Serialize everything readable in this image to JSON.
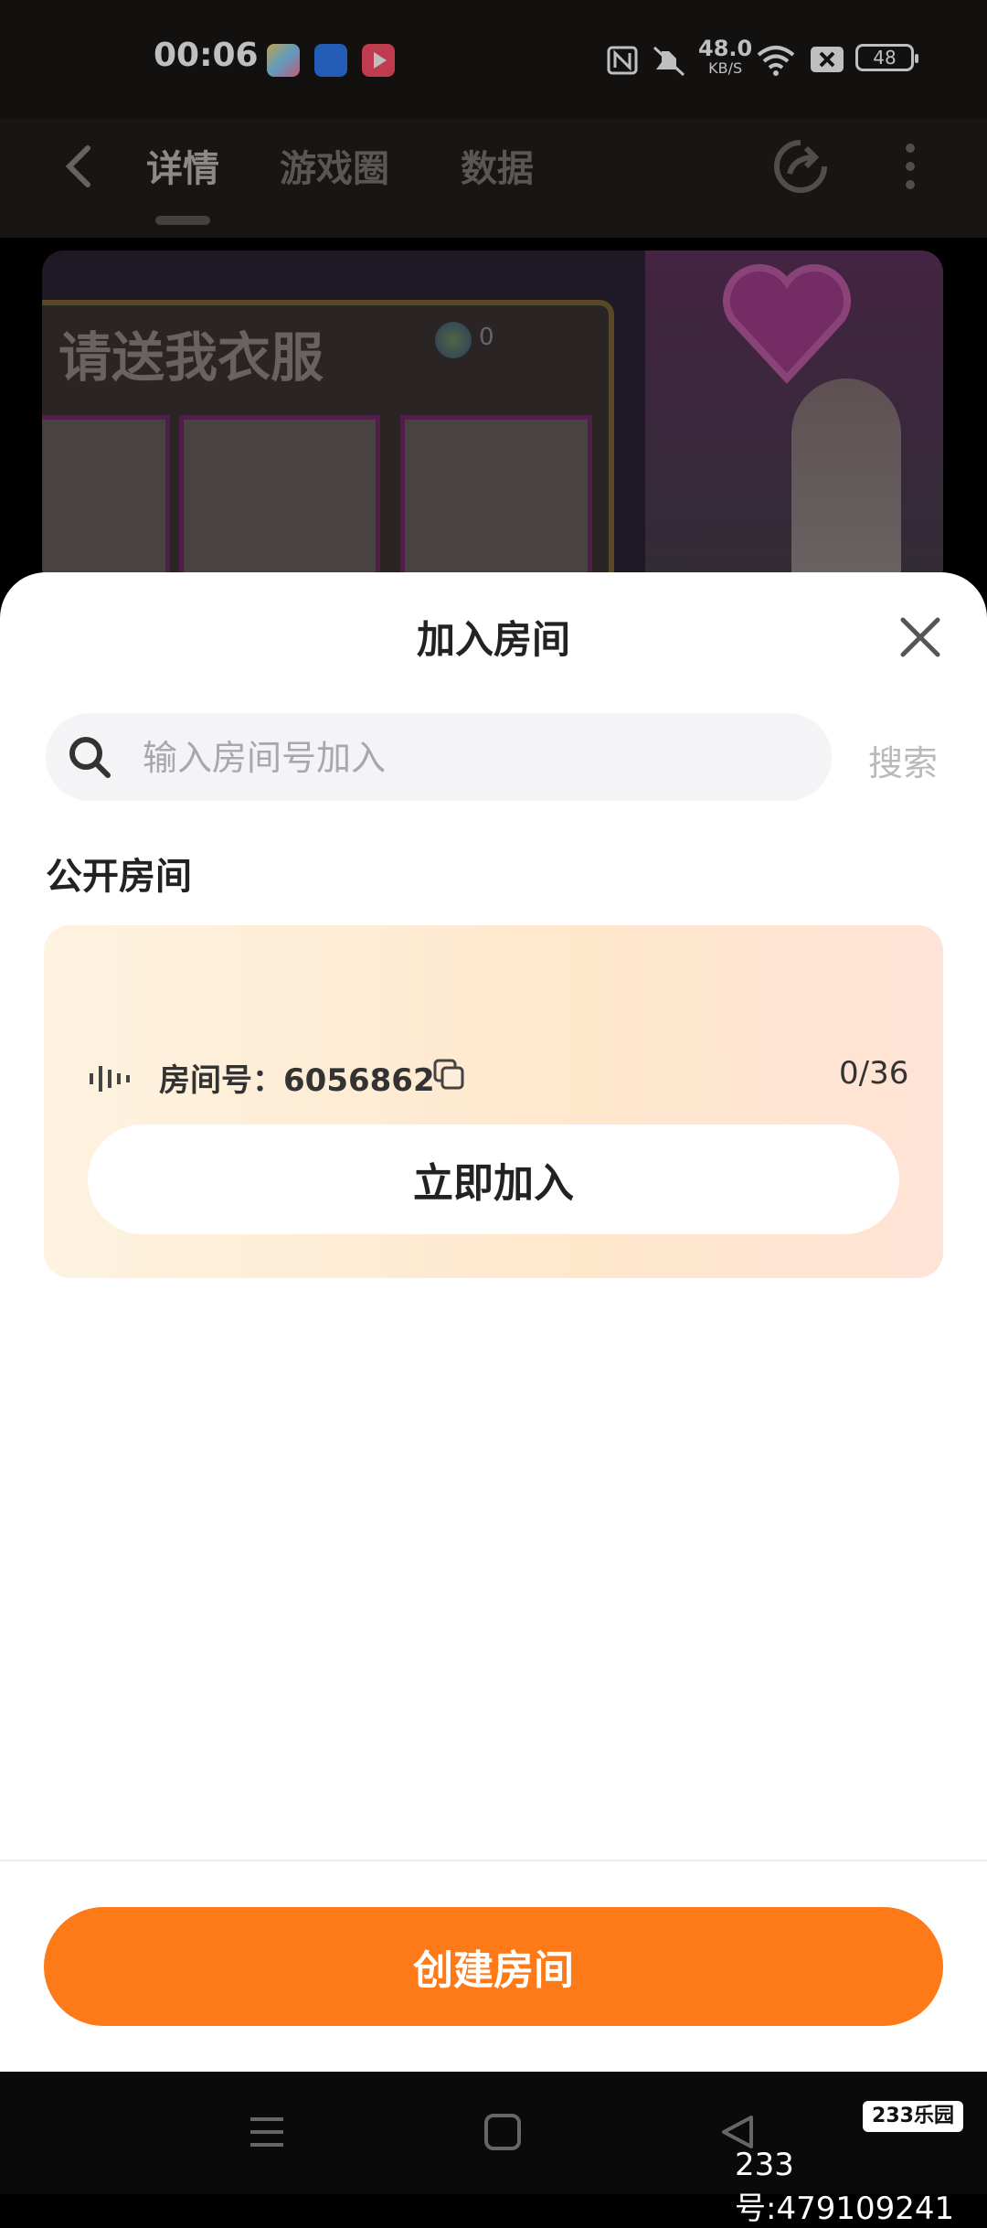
{
  "status_bar": {
    "time": "00:06",
    "network_speed": "48.0",
    "network_unit": "KB/S",
    "battery": "48"
  },
  "header": {
    "tabs": [
      {
        "label": "详情",
        "active": true
      },
      {
        "label": "游戏圈",
        "active": false
      },
      {
        "label": "数据",
        "active": false
      }
    ]
  },
  "banner": {
    "title": "请送我衣服",
    "coin_count": "0"
  },
  "sheet": {
    "title": "加入房间",
    "search": {
      "placeholder": "输入房间号加入",
      "button_label": "搜索"
    },
    "section_title": "公开房间",
    "rooms": [
      {
        "label": "房间号：6056862",
        "count": "0/36",
        "join_label": "立即加入"
      }
    ],
    "create_label": "创建房间"
  },
  "watermark": {
    "badge": "233乐园",
    "text": "233号:479109241"
  },
  "colors": {
    "accent": "#fe7a18",
    "card_start": "#fdf3e0",
    "card_end": "#ffe3d6"
  }
}
